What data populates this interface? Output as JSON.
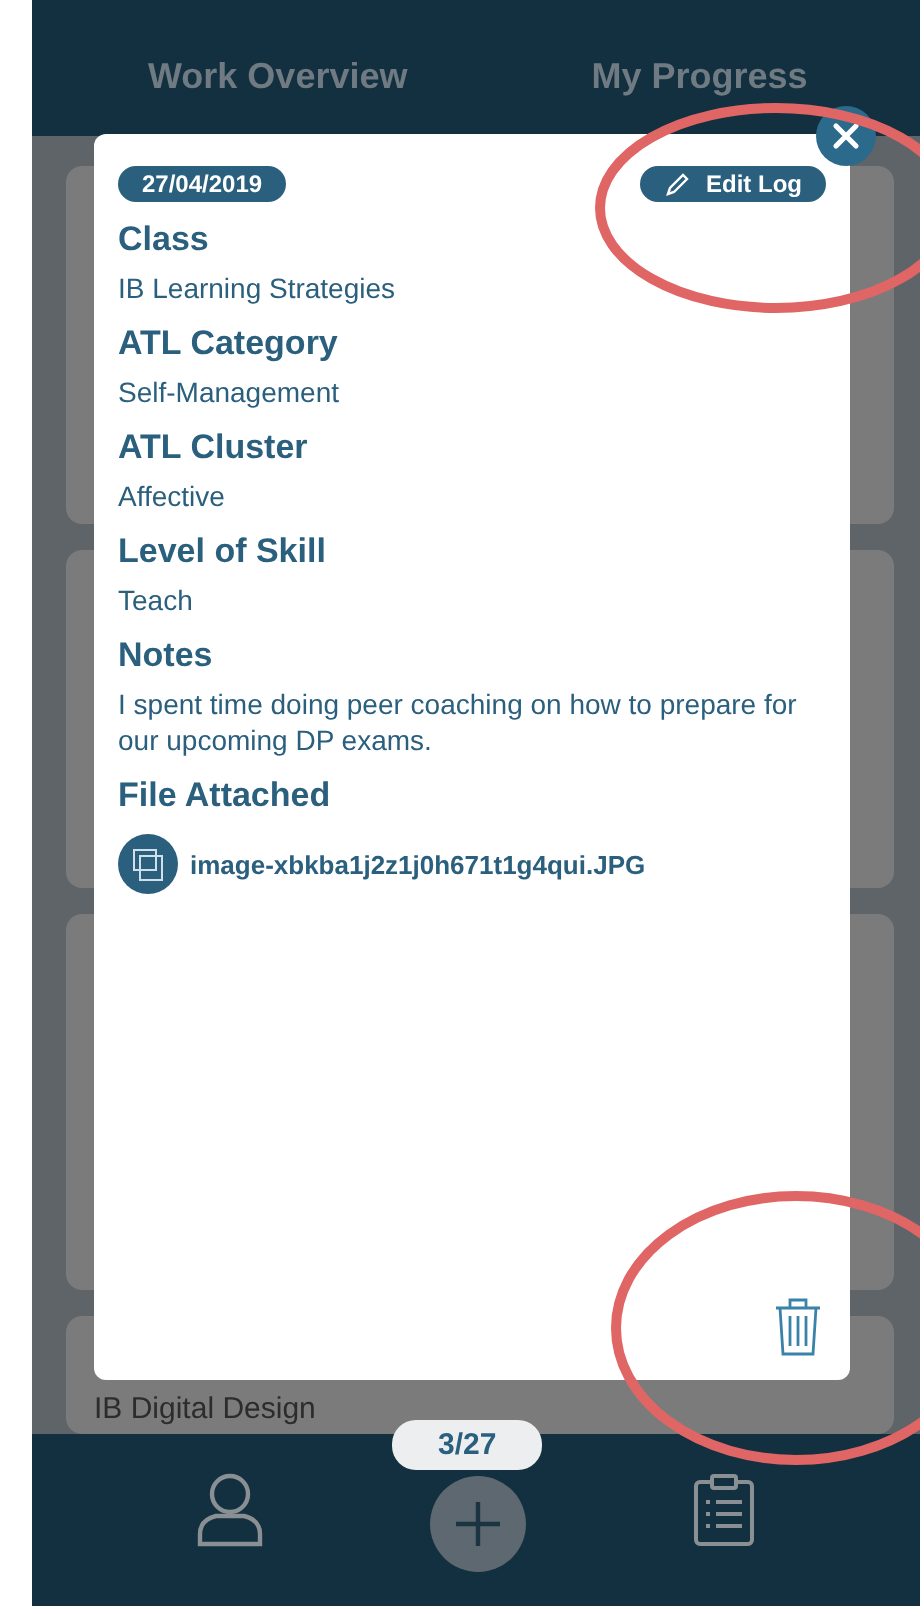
{
  "tabs": [
    {
      "label": "Work Overview",
      "selected": false
    },
    {
      "label": "My Progress",
      "selected": false
    }
  ],
  "background_card_title": "IB Digital Design",
  "log": {
    "date": "27/04/2019",
    "edit_button": "Edit Log",
    "fields": [
      {
        "label": "Class",
        "value": "IB Learning Strategies"
      },
      {
        "label": "ATL Category",
        "value": "Self-Management"
      },
      {
        "label": "ATL Cluster",
        "value": "Affective"
      },
      {
        "label": "Level of Skill",
        "value": "Teach"
      },
      {
        "label": "Notes",
        "value": "I spent time doing peer coaching on how to prepare for our upcoming DP exams."
      }
    ],
    "file_label": "File Attached",
    "file_name": "image-xbkba1j2z1j0h671t1g4qui.JPG"
  },
  "pager": "3/27"
}
